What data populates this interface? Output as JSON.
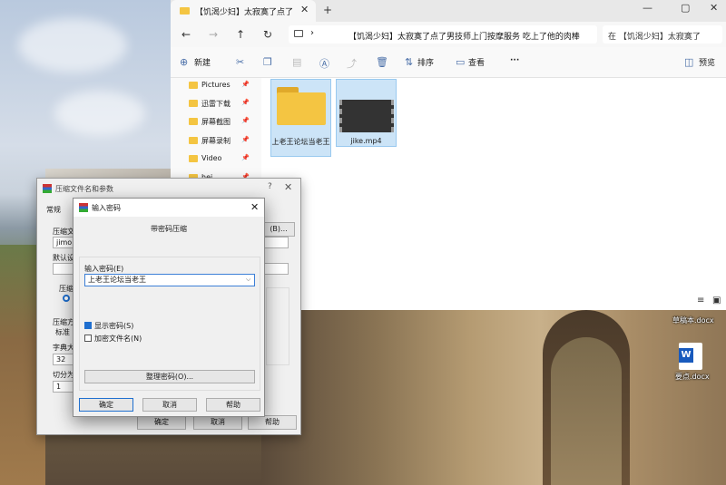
{
  "explorer": {
    "tab_title": "【饥渴少妇】太寂寞了点了男技",
    "tab_close": "✕",
    "tab_new": "+",
    "window_controls": [
      "—",
      "▢",
      "✕"
    ],
    "address_text": "【饥渴少妇】太寂寞了点了男技师上门按摩服务 吃上了他的肉棒",
    "search_placeholder": "在 【饥渴少妇】太寂寞了",
    "toolbar": {
      "new_label": "新建",
      "sort_label": "排序",
      "view_label": "查看",
      "more_label": "···",
      "preview_label": "预览"
    },
    "nav_items": [
      {
        "label": "Pictures"
      },
      {
        "label": "迅雷下载"
      },
      {
        "label": "屏幕截图"
      },
      {
        "label": "屏幕录制"
      },
      {
        "label": "Video"
      },
      {
        "label": "hei"
      }
    ],
    "files": [
      {
        "label": "上老王论坛当老王",
        "type": "folder"
      },
      {
        "label": "jike.mp4",
        "type": "video"
      }
    ]
  },
  "archive_dialog": {
    "title": "压缩文件名和参数",
    "tab_general": "常规",
    "archive_name_label": "压缩文",
    "archive_name_value": "jimo",
    "browse_button": "(B)...",
    "default_label": "默认设",
    "format_label": "压缩文",
    "method_label": "压缩方",
    "method_value": "标准",
    "dict_label": "字典大",
    "dict_value": "32",
    "split_label": "切分为",
    "split_value": "1",
    "ok_button": "确定",
    "cancel_button": "取消",
    "help_button": "帮助"
  },
  "password_dialog": {
    "title": "输入密码",
    "heading": "带密码压缩",
    "input_label": "输入密码(E)",
    "input_value": "上老王论坛当老王",
    "show_password_label": "显示密码(S)",
    "encrypt_names_label": "加密文件名(N)",
    "organize_button": "整理密码(O)...",
    "ok_button": "确定",
    "cancel_button": "取消",
    "help_button": "帮助"
  },
  "desktop": {
    "doc1_label": "草稿本.docx",
    "doc2_label": "要点.docx"
  }
}
